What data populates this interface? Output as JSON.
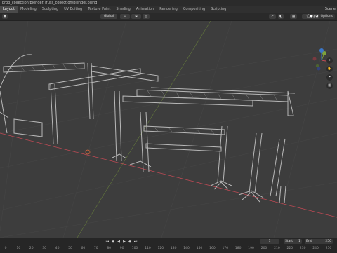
{
  "window": {
    "title": "prop_collection/blender/Truss_collection/blender.blend"
  },
  "menu": {
    "workspaces": [
      "Layout",
      "Modeling",
      "Sculpting",
      "UV Editing",
      "Texture Paint",
      "Shading",
      "Animation",
      "Rendering",
      "Compositing",
      "Scripting"
    ],
    "active_workspace": "Layout",
    "scene_label": "Scene"
  },
  "header": {
    "shading_global": "Global",
    "options_label": "Options"
  },
  "timeline": {
    "current_frame": "1",
    "start_label": "Start",
    "start_value": "1",
    "end_label": "End",
    "end_value": "250",
    "ruler_ticks": [
      "0",
      "10",
      "20",
      "30",
      "40",
      "50",
      "60",
      "70",
      "80",
      "90",
      "100",
      "110",
      "120",
      "130",
      "140",
      "150",
      "160",
      "170",
      "180",
      "190",
      "200",
      "210",
      "220",
      "230",
      "240",
      "250"
    ]
  },
  "viewport": {
    "axis_colors": {
      "x": "#c44a55",
      "y": "#7ea23b",
      "z": "#3a77c9"
    },
    "grid_color": "#4a4a4a"
  },
  "gizmo": {
    "x_label": "X",
    "y_label": "Y",
    "z_label": "Z"
  }
}
